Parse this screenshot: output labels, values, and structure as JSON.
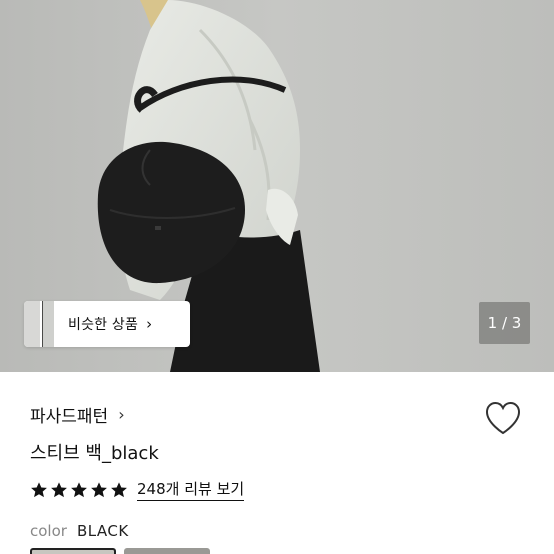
{
  "gallery": {
    "similar_label": "비슷한 상품",
    "chevron": "›",
    "page_counter": "1 / 3"
  },
  "product": {
    "brand": "파사드패턴",
    "brand_chevron": "›",
    "title": "스티브 백_black",
    "rating_stars": 5,
    "review_link": "248개 리뷰 보기",
    "color_key": "color",
    "color_value": "BLACK"
  },
  "colors": {
    "star": "#111111",
    "hero_bg": "#bfc0bd"
  },
  "icons": {
    "wishlist": "heart-outline-icon",
    "star": "star-filled-icon"
  }
}
